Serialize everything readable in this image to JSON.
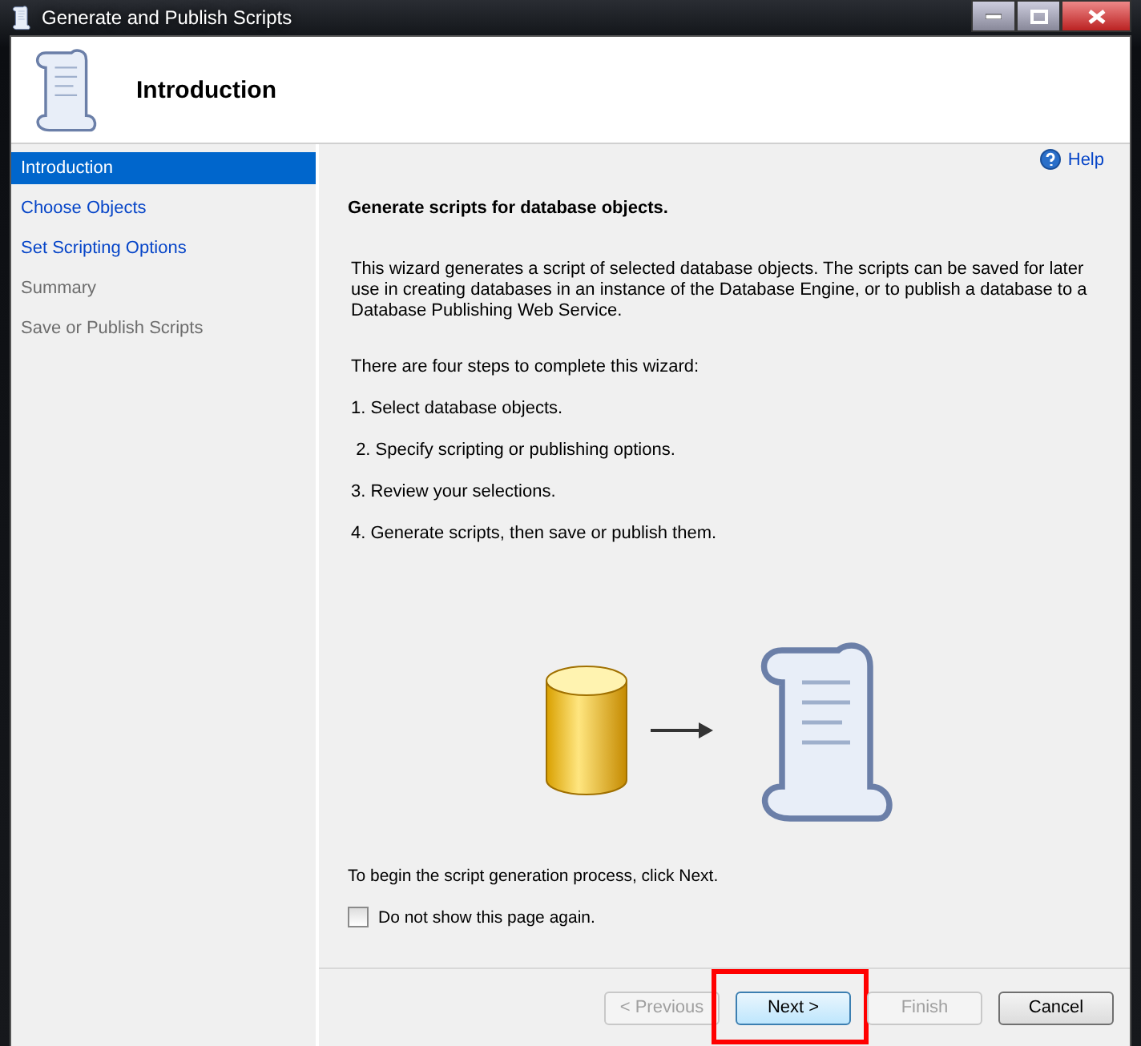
{
  "window": {
    "title": "Generate and Publish Scripts"
  },
  "header": {
    "title": "Introduction"
  },
  "sidebar": {
    "items": [
      {
        "label": "Introduction",
        "selected": true,
        "disabled": false
      },
      {
        "label": "Choose Objects",
        "selected": false,
        "disabled": false
      },
      {
        "label": "Set Scripting Options",
        "selected": false,
        "disabled": false
      },
      {
        "label": "Summary",
        "selected": false,
        "disabled": true
      },
      {
        "label": "Save or Publish Scripts",
        "selected": false,
        "disabled": true
      }
    ]
  },
  "help": {
    "label": "Help"
  },
  "content": {
    "heading": "Generate scripts for database objects.",
    "paragraphs": [
      "This wizard generates a script of selected database objects. The scripts can be saved for later use in creating databases in an instance of the Database Engine, or to publish a database to a Database Publishing Web Service.",
      "There are four steps to complete this wizard:",
      "1. Select database objects.",
      " 2. Specify scripting or publishing options.",
      "3. Review your selections.",
      "4. Generate scripts, then save or publish them."
    ],
    "footer_text": "To begin the script generation process, click Next.",
    "checkbox": {
      "label": "Do not show this page again.",
      "checked": false
    }
  },
  "buttons": [
    {
      "label": "< Previous",
      "disabled": true,
      "default": false,
      "highlighted": false
    },
    {
      "label": "Next >",
      "disabled": false,
      "default": true,
      "highlighted": true
    },
    {
      "label": "Finish",
      "disabled": true,
      "default": false,
      "highlighted": false
    },
    {
      "label": "Cancel",
      "disabled": false,
      "default": false,
      "highlighted": false
    }
  ]
}
